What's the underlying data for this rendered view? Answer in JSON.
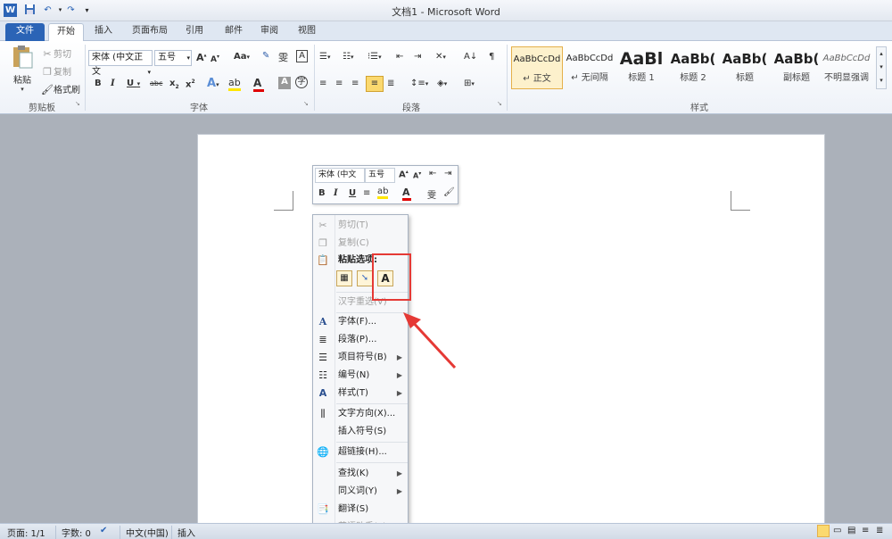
{
  "window": {
    "title": "文档1 - Microsoft Word"
  },
  "quick_access": {
    "save_icon": "save-icon",
    "undo_icon": "undo-icon",
    "redo_icon": "redo-icon",
    "customize_icon": "customize-icon"
  },
  "tabs": [
    "文件",
    "开始",
    "插入",
    "页面布局",
    "引用",
    "邮件",
    "审阅",
    "视图"
  ],
  "ribbon": {
    "clipboard": {
      "paste": "粘贴",
      "cut": "剪切",
      "copy": "复制",
      "format_painter": "格式刷",
      "label": "剪贴板"
    },
    "font": {
      "font_name": "宋体 (中文正文",
      "font_size": "五号",
      "label": "字体",
      "change_case": "Aa",
      "grow": "A",
      "shrink": "A"
    },
    "paragraph": {
      "label": "段落"
    },
    "styles": {
      "label": "样式",
      "items": [
        {
          "sample": "AaBbCcDd",
          "name": "↵ 正文"
        },
        {
          "sample": "AaBbCcDd",
          "name": "↵ 无间隔"
        },
        {
          "sample": "AaBl",
          "name": "标题 1"
        },
        {
          "sample": "AaBb(",
          "name": "标题 2"
        },
        {
          "sample": "AaBb(",
          "name": "标题"
        },
        {
          "sample": "AaBb(",
          "name": "副标题"
        },
        {
          "sample": "AaBbCcDd",
          "name": "不明显强调"
        }
      ]
    }
  },
  "mini_toolbar": {
    "font_name": "宋体 (中文",
    "font_size": "五号"
  },
  "context_menu": {
    "items": [
      {
        "label": "剪切(T)",
        "icon": "scissors-icon",
        "disabled": true
      },
      {
        "label": "复制(C)",
        "icon": "copy-icon",
        "disabled": true
      },
      {
        "label": "粘贴选项:",
        "icon": "paste-icon",
        "disabled": false
      },
      {
        "label": "汉字重选(V)",
        "icon": "",
        "disabled": true
      },
      {
        "label": "字体(F)...",
        "icon": "font-icon",
        "disabled": false
      },
      {
        "label": "段落(P)...",
        "icon": "paragraph-icon",
        "disabled": false
      },
      {
        "label": "项目符号(B)",
        "icon": "bullets-icon",
        "disabled": false
      },
      {
        "label": "编号(N)",
        "icon": "numbering-icon",
        "disabled": false
      },
      {
        "label": "样式(T)",
        "icon": "styles-icon",
        "disabled": false
      },
      {
        "label": "文字方向(X)...",
        "icon": "text-direction-icon",
        "disabled": false
      },
      {
        "label": "插入符号(S)",
        "icon": "",
        "disabled": false
      },
      {
        "label": "超链接(H)...",
        "icon": "hyperlink-icon",
        "disabled": false
      },
      {
        "label": "查找(K)",
        "icon": "",
        "disabled": false
      },
      {
        "label": "同义词(Y)",
        "icon": "",
        "disabled": false
      },
      {
        "label": "翻译(S)",
        "icon": "translate-icon",
        "disabled": false
      },
      {
        "label": "英语助手(E)",
        "icon": "english-assistant-icon",
        "disabled": true
      }
    ]
  },
  "status_bar": {
    "page": "页面: 1/1",
    "words": "字数: 0",
    "language": "中文(中国)",
    "mode": "插入"
  },
  "colors": {
    "file_tab": "#2b64b6",
    "highlight_box": "#e53935",
    "arrow": "#e53935"
  }
}
